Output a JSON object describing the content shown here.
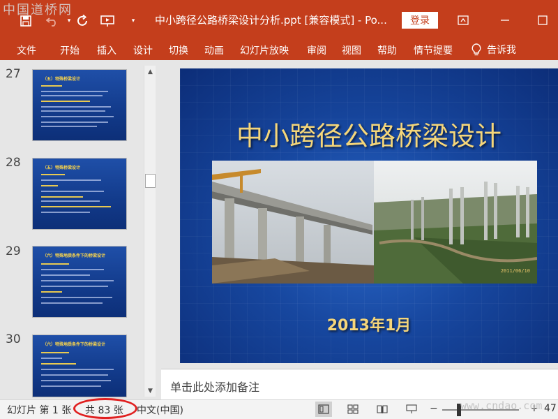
{
  "watermark_top": "中国道桥网",
  "watermark_bottom": "www.cndao.com",
  "window": {
    "title": "中小跨径公路桥梁设计分析.ppt [兼容模式]  -  Po...",
    "login_label": "登录"
  },
  "quick_access": {
    "save_icon": "save-icon",
    "undo_icon": "undo-icon",
    "redo_icon": "redo-icon",
    "present_icon": "present-from-start-icon",
    "customize_icon": "customize-qat-icon"
  },
  "ribbon": {
    "tabs": [
      "文件",
      "开始",
      "插入",
      "设计",
      "切换",
      "动画",
      "幻灯片放映",
      "审阅",
      "视图",
      "帮助",
      "情节提要"
    ],
    "tell_me": "告诉我"
  },
  "thumbnails": [
    {
      "number": "27",
      "title": "（五）特殊桥梁设计"
    },
    {
      "number": "28",
      "title": "（五）特殊桥梁设计"
    },
    {
      "number": "29",
      "title": "（六）特殊地质条件下的桥梁设计"
    },
    {
      "number": "30",
      "title": "（六）特殊地质条件下的桥梁设计"
    }
  ],
  "slide": {
    "title": "中小跨径公路桥梁设计",
    "photo_caption": "2011/06/10",
    "date": "2013年1月"
  },
  "notes": {
    "placeholder": "单击此处添加备注"
  },
  "status_bar": {
    "slide_label": "幻灯片 第 1 张",
    "total_label": "共 83 张",
    "language": "中文(中国)",
    "zoom_minus": "−",
    "zoom_plus": "+",
    "zoom_percent": "47"
  },
  "colors": {
    "accent": "#c43e1c",
    "slide_title": "#f5d67a",
    "annotation": "#e02020"
  }
}
